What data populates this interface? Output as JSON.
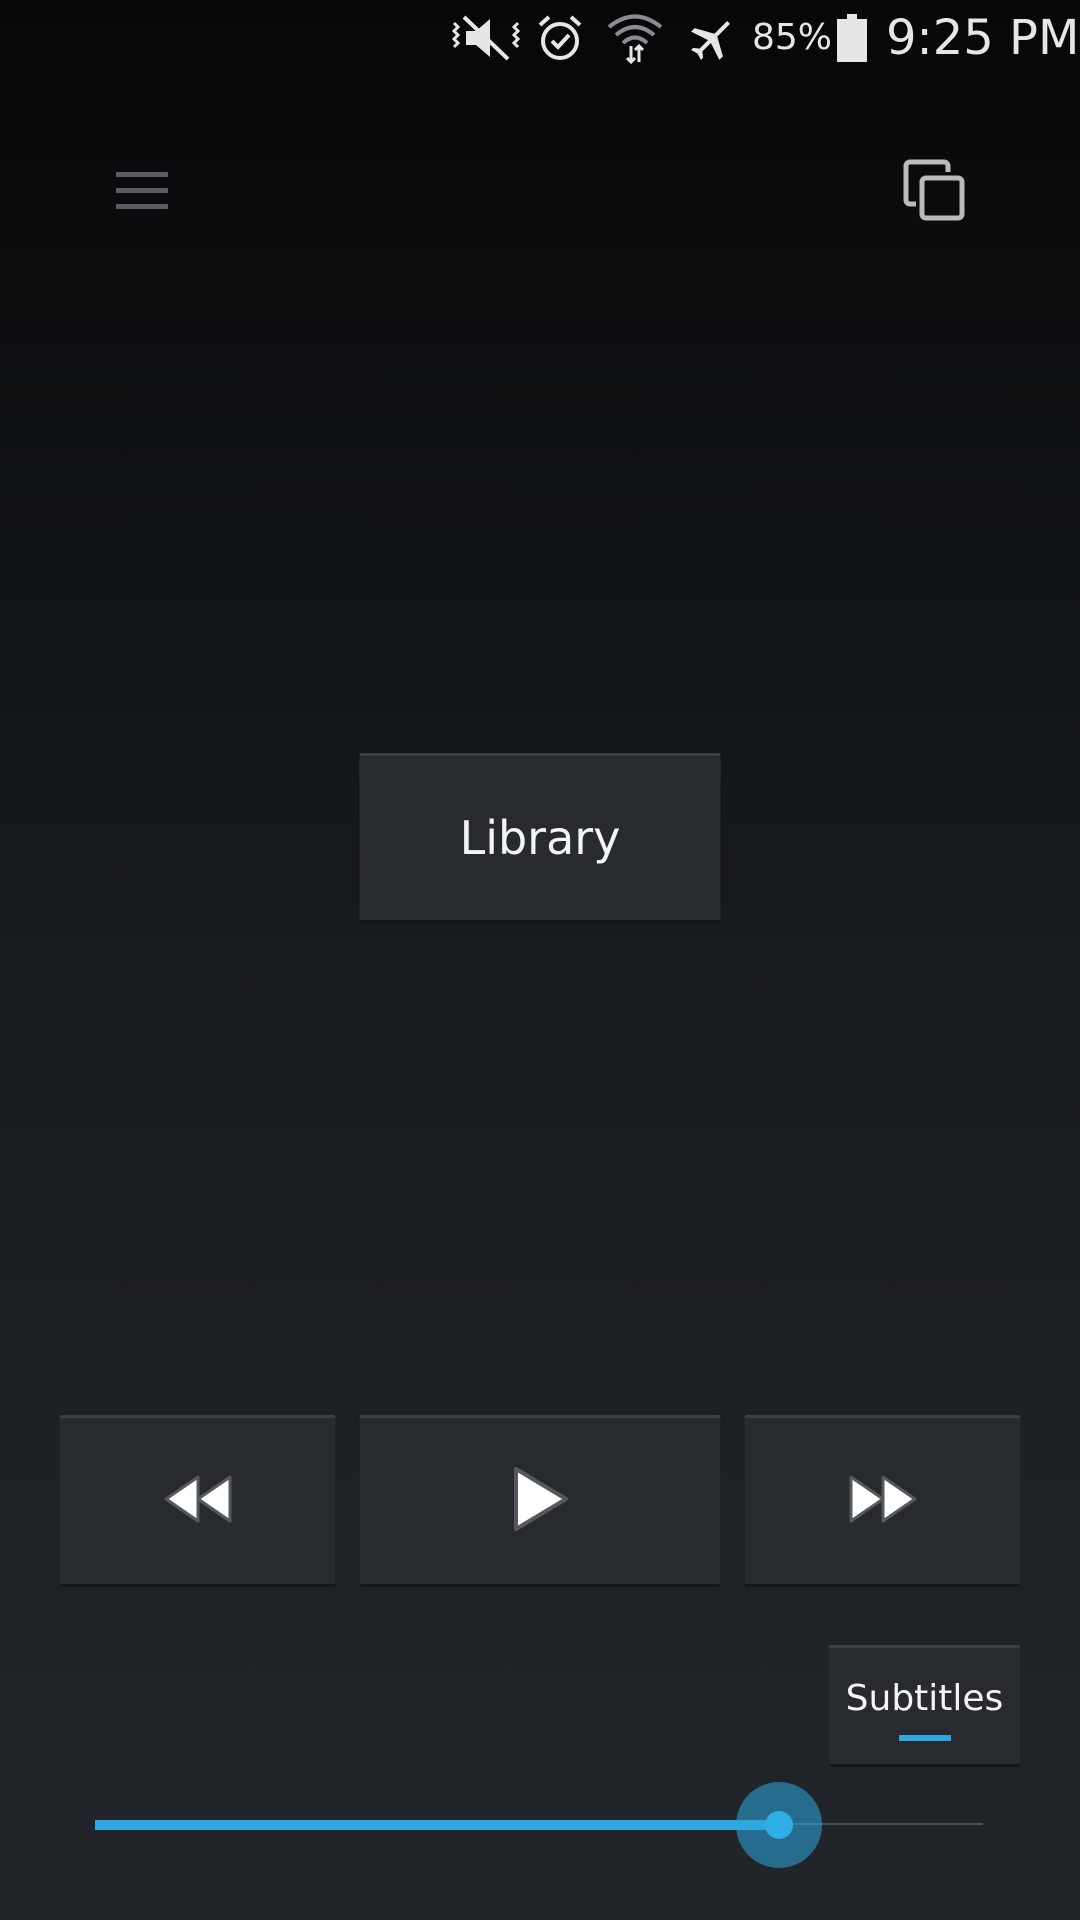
{
  "status_bar": {
    "icons": [
      "mute-vibrate-icon",
      "alarm-icon",
      "wifi-icon",
      "airplane-mode-icon",
      "battery-icon"
    ],
    "battery_percent": "85%",
    "time": "9:25 PM"
  },
  "toolbar": {
    "menu_icon": "hamburger-menu-icon",
    "cast_icon": "screen-mirror-icon"
  },
  "main": {
    "library_label": "Library"
  },
  "controls": {
    "rewind_icon": "rewind-icon",
    "play_icon": "play-icon",
    "forward_icon": "fast-forward-icon"
  },
  "subtitles": {
    "label": "Subtitles",
    "enabled": true
  },
  "slider": {
    "value_fraction": 0.77
  },
  "colors": {
    "accent": "#2ea8de",
    "panel": "#272b30"
  }
}
